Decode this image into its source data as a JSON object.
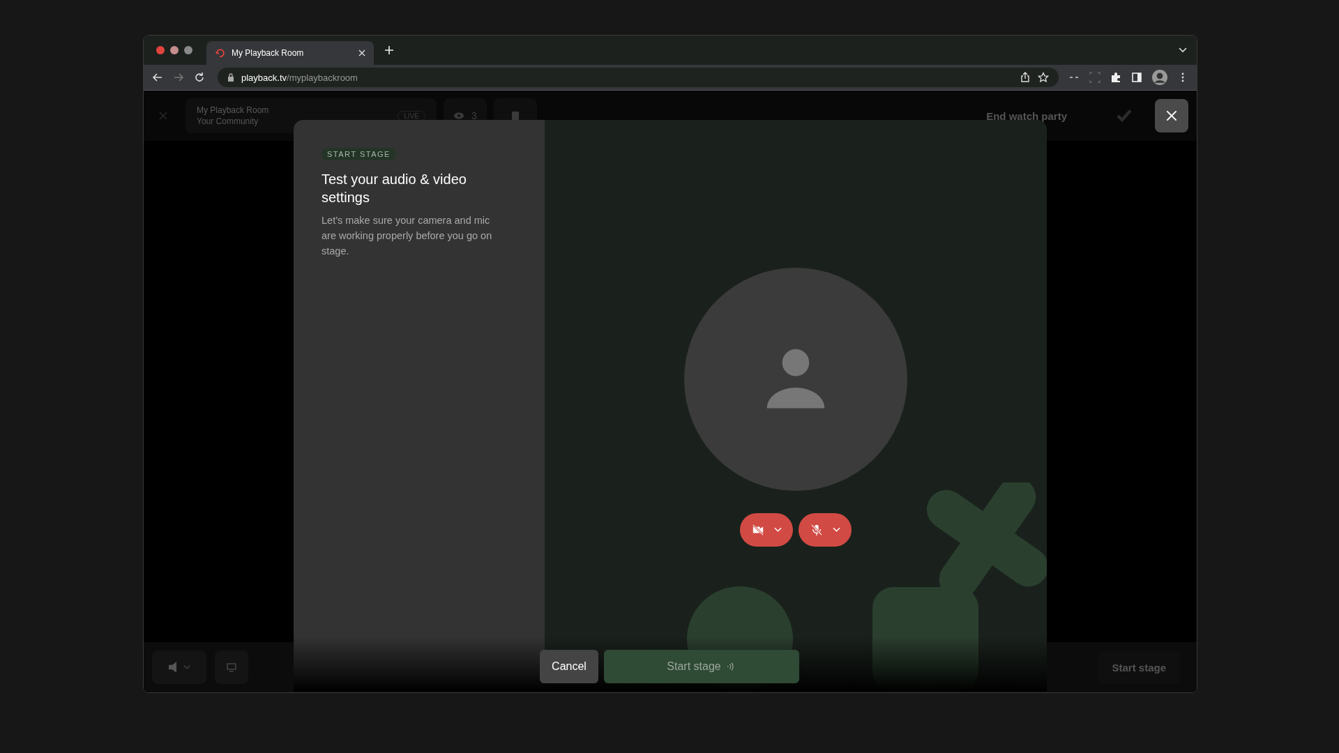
{
  "browser": {
    "tabs": [
      {
        "title": "My Playback Room",
        "selected": true
      }
    ],
    "address": {
      "host": "playback.tv",
      "path": "/myplaybackroom"
    }
  },
  "app_bar": {
    "room_title": "My Playback Room",
    "community": "Your Community",
    "live_badge": "LIVE",
    "viewers": "3",
    "end_party": "End watch party"
  },
  "bottom_bar": {
    "start_stage": "Start stage"
  },
  "dialog": {
    "eyebrow": "START STAGE",
    "title": "Test your audio & video settings",
    "description": "Let's make sure your camera and mic are working properly before you go on stage.",
    "controls": [
      {
        "kind": "camera",
        "on": false
      },
      {
        "kind": "mic",
        "on": false
      }
    ],
    "buttons": [
      {
        "label": "Cancel",
        "kind": "cancel",
        "disabled": false
      },
      {
        "label": "Start stage",
        "kind": "primary",
        "disabled": true
      }
    ]
  }
}
